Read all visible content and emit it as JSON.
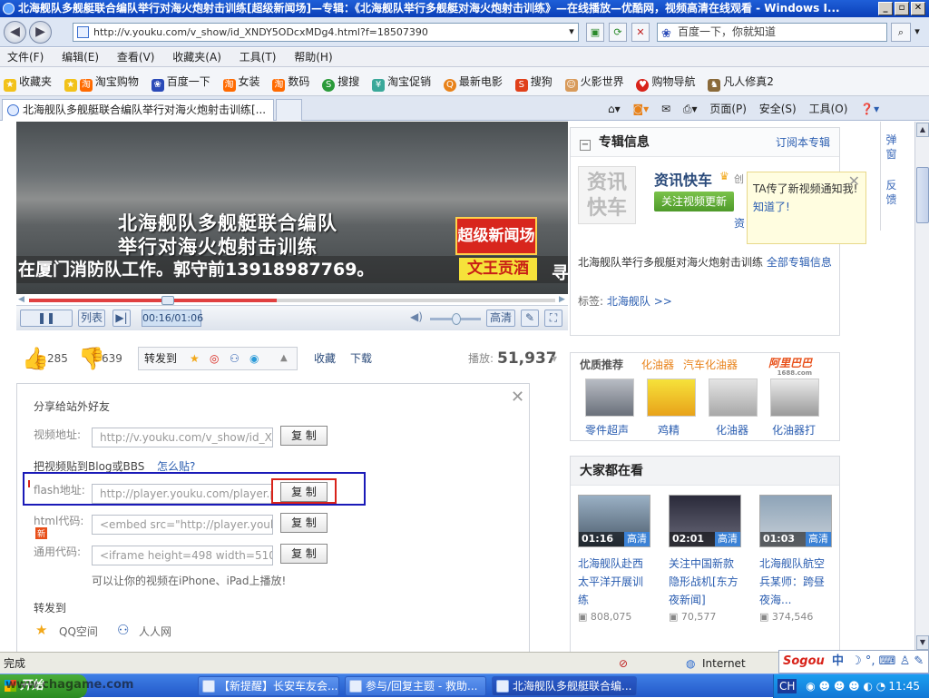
{
  "window": {
    "title": "北海舰队多舰艇联合编队举行对海火炮射击训练[超级新闻场]—专辑：《北海舰队举行多舰艇对海火炮射击训练》—在线播放—优酷网，视频高清在线观看 - Windows I...",
    "min": "_",
    "max": "▫",
    "close": "✕"
  },
  "address": {
    "url": "http://v.youku.com/v_show/id_XNDY5ODcxMDg4.html?f=18507390",
    "search_placeholder": "百度一下，你就知道"
  },
  "menu": [
    "文件(F)",
    "编辑(E)",
    "查看(V)",
    "收藏夹(A)",
    "工具(T)",
    "帮助(H)"
  ],
  "favorites": {
    "label": "收藏夹",
    "items": [
      "淘宝购物",
      "百度一下",
      "女装",
      "数码",
      "搜搜",
      "淘宝促销",
      "最新电影",
      "搜狗",
      "火影世界",
      "购物导航",
      "凡人修真2"
    ]
  },
  "tab": {
    "title": "北海舰队多舰艇联合编队举行对海火炮射击训练[..."
  },
  "commandbar": {
    "page": "页面(P)",
    "safety": "安全(S)",
    "tools": "工具(O)"
  },
  "video": {
    "caption1": "北海舰队多舰艇联合编队",
    "caption2": "举行对海火炮射击训练",
    "ticker": "在厦门消防队工作。郭守前13918987769。",
    "ticker_tail": "寻",
    "logo1": "超级新闻场",
    "logo2": "文王贡酒",
    "time": "00:16/01:06",
    "list_btn": "列表",
    "hd_btn": "高清",
    "progress_fraction": 0.47,
    "volume_fraction": 0.5
  },
  "stats": {
    "likes": "285",
    "dislikes": "639",
    "forward_label": "转发到",
    "collect": "收藏",
    "download": "下载",
    "plays_label": "播放:",
    "plays": "51,937"
  },
  "share": {
    "title": "分享给站外好友",
    "video_url_label": "视频地址:",
    "video_url": "http://v.youku.com/v_show/id_XNDY5ODcxMDg4",
    "blog_label": "把视频贴到Blog或BBS",
    "how_label": "怎么贴?",
    "flash_label": "flash地址:",
    "flash_url": "http://player.youku.com/player.php/sid/XNDY",
    "html_label": "html代码:",
    "html_code": "<embed src=\"http://player.youku.com/player.php",
    "new_badge": "新",
    "generic_label": "通用代码:",
    "generic_code": "<iframe height=498 width=510 frameborder=0",
    "copy": "复 制",
    "iphone_note": "可以让你的视频在iPhone、iPad上播放!",
    "forward_title": "转发到",
    "qq_space": "QQ空间",
    "renren": "人人网"
  },
  "album": {
    "header": "专辑信息",
    "subscribe": "订阅本专辑",
    "logo_text": "资讯快车",
    "name": "资讯快车",
    "follow_btn": "关注视频更新",
    "tooltip": "TA传了新视频通知我!",
    "tooltip_ok": "知道了!",
    "desc": "北海舰队举行多舰艇对海火炮射击训练",
    "all_link": "全部专辑信息",
    "tag_label": "标签:",
    "tag": "北海舰队",
    "side_popup": "弹窗",
    "side_feedback": "反馈",
    "partial_text_1": "创",
    "partial_text_2": "资"
  },
  "recommend": {
    "header": "优质推荐",
    "tag1": "化油器",
    "tag2": "汽车化油器",
    "brand": "阿里巴巴",
    "brand_sub": "1688.com",
    "items": [
      "零件超声",
      "鸡精",
      "化油器",
      "化油器打"
    ]
  },
  "everyone": {
    "header": "大家都在看",
    "items": [
      {
        "dur": "01:16",
        "hd": "高清",
        "title1": "北海舰队赴西",
        "title2": "太平洋开展训",
        "title3": "练",
        "plays": "808,075"
      },
      {
        "dur": "02:01",
        "hd": "高清",
        "title1": "关注中国新款",
        "title2": "隐形战机[东方",
        "title3": "夜新闻]",
        "plays": "70,577"
      },
      {
        "dur": "01:03",
        "hd": "高清",
        "title1": "北海舰队航空",
        "title2": "兵某师：跨昼",
        "title3": "夜海...",
        "plays": "374,546"
      }
    ]
  },
  "status": {
    "text": "完成",
    "zone": "Internet"
  },
  "sogou": {
    "brand": "Sogou",
    "mode": "中"
  },
  "taskbar": {
    "start": "开始",
    "watermark": "www.chagame.com",
    "tasks": [
      "【新提醒】长安车友会...",
      "参与/回复主题 - 救助...",
      "北海舰队多舰艇联合编..."
    ],
    "lang": "CH",
    "clock": "11:45"
  }
}
